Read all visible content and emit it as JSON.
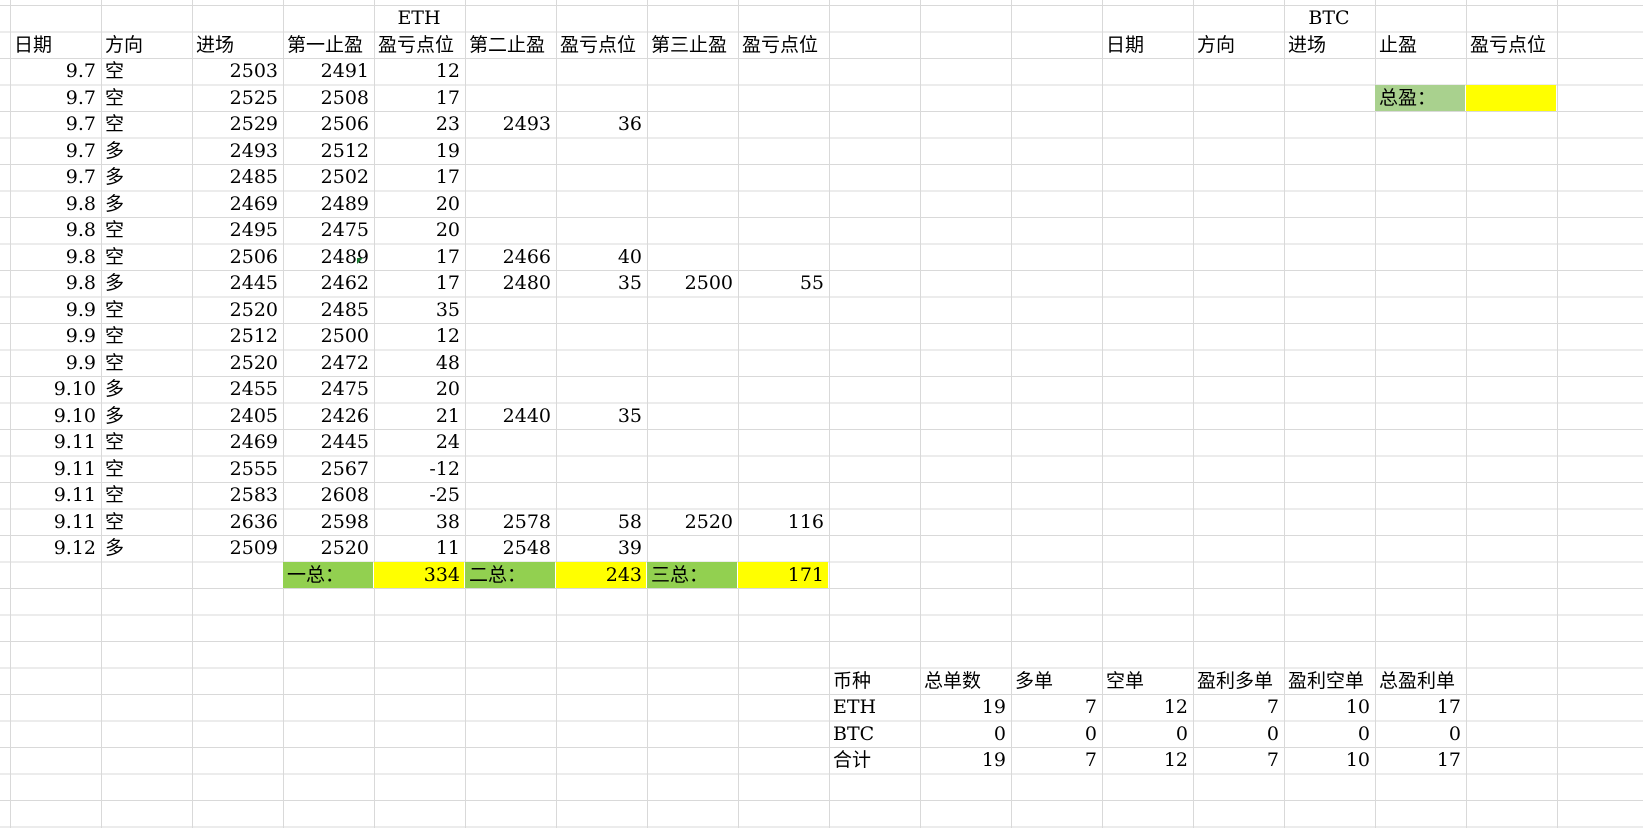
{
  "eth": {
    "title": "ETH",
    "headers": [
      "日期",
      "方向",
      "进场",
      "第一止盈",
      "盈亏点位",
      "第二止盈",
      "盈亏点位",
      "第三止盈",
      "盈亏点位"
    ],
    "rows": [
      [
        "9.7",
        "空",
        "2503",
        "2491",
        "12",
        "",
        "",
        "",
        ""
      ],
      [
        "9.7",
        "空",
        "2525",
        "2508",
        "17",
        "",
        "",
        "",
        ""
      ],
      [
        "9.7",
        "空",
        "2529",
        "2506",
        "23",
        "2493",
        "36",
        "",
        ""
      ],
      [
        "9.7",
        "多",
        "2493",
        "2512",
        "19",
        "",
        "",
        "",
        ""
      ],
      [
        "9.7",
        "多",
        "2485",
        "2502",
        "17",
        "",
        "",
        "",
        ""
      ],
      [
        "9.8",
        "多",
        "2469",
        "2489",
        "20",
        "",
        "",
        "",
        ""
      ],
      [
        "9.8",
        "空",
        "2495",
        "2475",
        "20",
        "",
        "",
        "",
        ""
      ],
      [
        "9.8",
        "空",
        "2506",
        "2489",
        "17",
        "2466",
        "40",
        "",
        ""
      ],
      [
        "9.8",
        "多",
        "2445",
        "2462",
        "17",
        "2480",
        "35",
        "2500",
        "55"
      ],
      [
        "9.9",
        "空",
        "2520",
        "2485",
        "35",
        "",
        "",
        "",
        ""
      ],
      [
        "9.9",
        "空",
        "2512",
        "2500",
        "12",
        "",
        "",
        "",
        ""
      ],
      [
        "9.9",
        "空",
        "2520",
        "2472",
        "48",
        "",
        "",
        "",
        ""
      ],
      [
        "9.10",
        "多",
        "2455",
        "2475",
        "20",
        "",
        "",
        "",
        ""
      ],
      [
        "9.10",
        "多",
        "2405",
        "2426",
        "21",
        "2440",
        "35",
        "",
        ""
      ],
      [
        "9.11",
        "空",
        "2469",
        "2445",
        "24",
        "",
        "",
        "",
        ""
      ],
      [
        "9.11",
        "空",
        "2555",
        "2567",
        "-12",
        "",
        "",
        "",
        ""
      ],
      [
        "9.11",
        "空",
        "2583",
        "2608",
        "-25",
        "",
        "",
        "",
        ""
      ],
      [
        "9.11",
        "空",
        "2636",
        "2598",
        "38",
        "2578",
        "58",
        "2520",
        "116"
      ],
      [
        "9.12",
        "多",
        "2509",
        "2520",
        "11",
        "2548",
        "39",
        "",
        ""
      ]
    ],
    "totals": {
      "first_label": "一总：",
      "first_value": "334",
      "second_label": "二总：",
      "second_value": "243",
      "third_label": "三总：",
      "third_value": "171"
    }
  },
  "btc": {
    "title": "BTC",
    "headers": [
      "日期",
      "方向",
      "进场",
      "止盈",
      "盈亏点位"
    ],
    "total_label": "总盈：",
    "total_value": ""
  },
  "summary": {
    "headers": [
      "币种",
      "总单数",
      "多单",
      "空单",
      "盈利多单",
      "盈利空单",
      "总盈利单"
    ],
    "rows": [
      [
        "ETH",
        "19",
        "7",
        "12",
        "7",
        "10",
        "17"
      ],
      [
        "BTC",
        "0",
        "0",
        "0",
        "0",
        "0",
        "0"
      ],
      [
        "合计",
        "19",
        "7",
        "12",
        "7",
        "10",
        "17"
      ]
    ]
  },
  "colors": {
    "green_fill": "#92d050",
    "yellow_fill": "#ffff00",
    "light_green_fill": "#a9d18e",
    "gridline": "#d9d9d9"
  }
}
